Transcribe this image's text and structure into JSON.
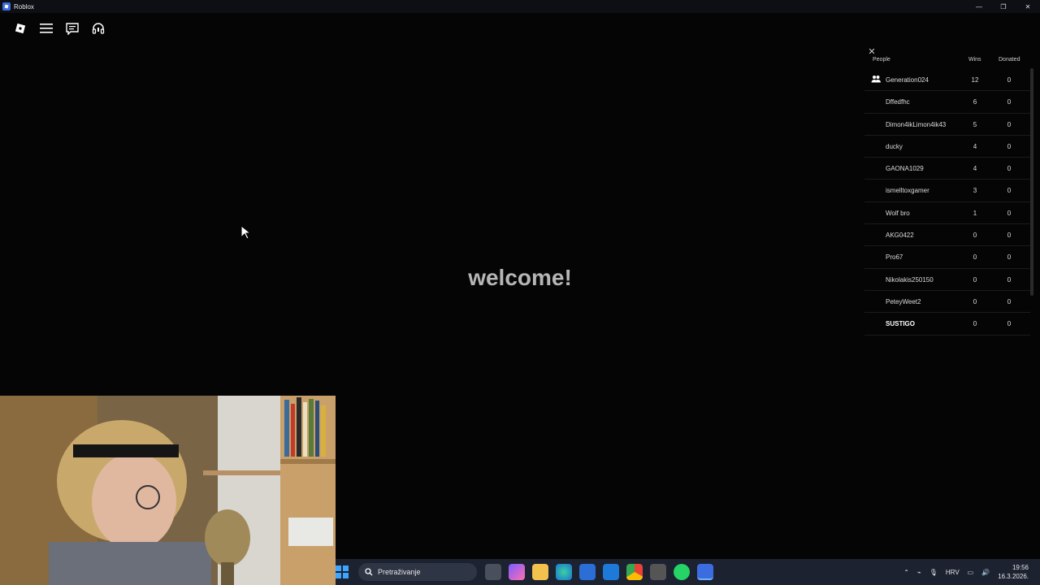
{
  "window": {
    "title": "Roblox",
    "controls": [
      "—",
      "❐",
      "✕"
    ]
  },
  "topbar": {
    "icons": [
      "roblox-logo-icon",
      "menu-icon",
      "chat-icon",
      "headset-icon"
    ]
  },
  "welcome_text": "welcome!",
  "leaderboard": {
    "columns": {
      "people": "People",
      "wins": "Wins",
      "donated": "Donated"
    },
    "rows": [
      {
        "name": "Generation024",
        "wins": "12",
        "donated": "0"
      },
      {
        "name": "Dffedfhc",
        "wins": "6",
        "donated": "0"
      },
      {
        "name": "Dimon4ikLimon4ik43",
        "wins": "5",
        "donated": "0"
      },
      {
        "name": "ducky",
        "wins": "4",
        "donated": "0"
      },
      {
        "name": "GAONA1029",
        "wins": "4",
        "donated": "0"
      },
      {
        "name": "ismelltoxgamer",
        "wins": "3",
        "donated": "0"
      },
      {
        "name": "Wolf bro",
        "wins": "1",
        "donated": "0"
      },
      {
        "name": "AKG0422",
        "wins": "0",
        "donated": "0"
      },
      {
        "name": "Pro67",
        "wins": "0",
        "donated": "0"
      },
      {
        "name": "Nikolakis250150",
        "wins": "0",
        "donated": "0"
      },
      {
        "name": "PeteyWeet2",
        "wins": "0",
        "donated": "0"
      },
      {
        "name": "SUSTIGO",
        "wins": "0",
        "donated": "0"
      }
    ]
  },
  "taskbar": {
    "search_placeholder": "Pretraživanje",
    "language": "HRV",
    "time": "19:56",
    "date": "16.3.2026."
  }
}
